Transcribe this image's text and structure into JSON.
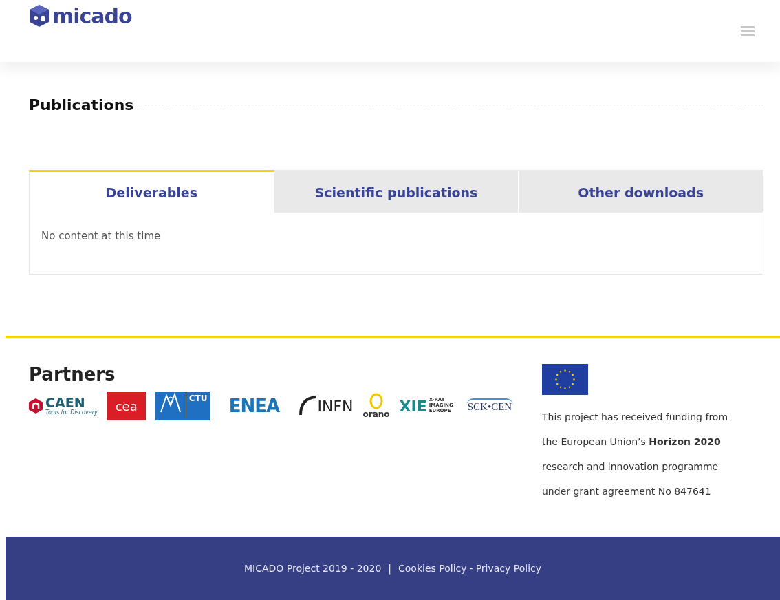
{
  "header": {
    "logo_text": "micado"
  },
  "page_title": "Publications",
  "tabs": [
    {
      "label": "Deliverables",
      "selected": true
    },
    {
      "label": "Scientific publications",
      "selected": false
    },
    {
      "label": "Other downloads",
      "selected": false
    }
  ],
  "tab_content": "No content at this time",
  "partners": {
    "title": "Partners",
    "logos": [
      {
        "kind": "caen",
        "label": "CAEN",
        "tagline": "Tools for Discovery"
      },
      {
        "kind": "cea",
        "label": "cea"
      },
      {
        "kind": "ctu",
        "label": "CTU"
      },
      {
        "kind": "enea",
        "label": "ENEA"
      },
      {
        "kind": "infn",
        "label": "INFN"
      },
      {
        "kind": "orano",
        "label": "orano"
      },
      {
        "kind": "xie",
        "label": "XIE",
        "tagline": "X-RAY IMAGING EUROPE"
      },
      {
        "kind": "sck",
        "label": "SCK•CEN"
      }
    ]
  },
  "funding": {
    "text": "This project has received funding from the European Union’s **Horizon 2020** research and innovation programme under grant agreement No 847641"
  },
  "footer": {
    "copyright": "MICADO Project 2019 - 2020",
    "separator": "|",
    "links": [
      {
        "label": "Cookies Policy"
      },
      {
        "label": "Privacy Policy"
      }
    ],
    "link_separator": "-"
  }
}
